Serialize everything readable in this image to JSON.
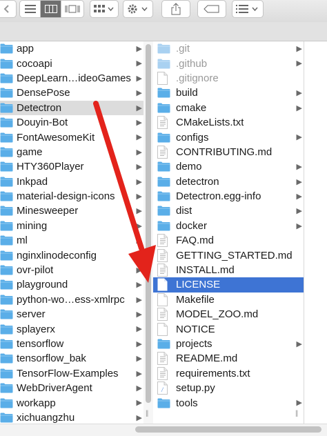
{
  "colors": {
    "folder": "#5aaee8",
    "selection_blue": "#3e74d4",
    "selection_grey": "#dcdcdc",
    "arrow": "#e3231b"
  },
  "toolbar": {
    "view_modes": [
      "list-view-icon",
      "column-view-icon",
      "gallery-view-icon"
    ],
    "active_view": "column-view",
    "buttons": [
      "arrange-icon",
      "action-gear-icon",
      "share-icon",
      "tag-icon",
      "group-icon"
    ]
  },
  "left_column": [
    {
      "name": "app",
      "type": "folder"
    },
    {
      "name": "cocoapi",
      "type": "folder"
    },
    {
      "name": "DeepLearn…ideoGames",
      "type": "folder"
    },
    {
      "name": "DensePose",
      "type": "folder"
    },
    {
      "name": "Detectron",
      "type": "folder",
      "selected": true
    },
    {
      "name": "Douyin-Bot",
      "type": "folder"
    },
    {
      "name": "FontAwesomeKit",
      "type": "folder"
    },
    {
      "name": "game",
      "type": "folder"
    },
    {
      "name": "HTY360Player",
      "type": "folder"
    },
    {
      "name": "Inkpad",
      "type": "folder"
    },
    {
      "name": "material-design-icons",
      "type": "folder"
    },
    {
      "name": "Minesweeper",
      "type": "folder"
    },
    {
      "name": "mining",
      "type": "folder"
    },
    {
      "name": "ml",
      "type": "folder"
    },
    {
      "name": "nginxlinodeconfig",
      "type": "folder"
    },
    {
      "name": "ovr-pilot",
      "type": "folder"
    },
    {
      "name": "playground",
      "type": "folder"
    },
    {
      "name": "python-wo…ess-xmlrpc",
      "type": "folder"
    },
    {
      "name": "server",
      "type": "folder"
    },
    {
      "name": "splayerx",
      "type": "folder"
    },
    {
      "name": "tensorflow",
      "type": "folder"
    },
    {
      "name": "tensorflow_bak",
      "type": "folder"
    },
    {
      "name": "TensorFlow-Examples",
      "type": "folder"
    },
    {
      "name": "WebDriverAgent",
      "type": "folder"
    },
    {
      "name": "workapp",
      "type": "folder"
    },
    {
      "name": "xichuangzhu",
      "type": "folder"
    }
  ],
  "right_column": [
    {
      "name": ".git",
      "type": "folder",
      "hidden": true
    },
    {
      "name": ".github",
      "type": "folder",
      "hidden": true
    },
    {
      "name": ".gitignore",
      "type": "file",
      "hidden": true
    },
    {
      "name": "build",
      "type": "folder"
    },
    {
      "name": "cmake",
      "type": "folder"
    },
    {
      "name": "CMakeLists.txt",
      "type": "text"
    },
    {
      "name": "configs",
      "type": "folder"
    },
    {
      "name": "CONTRIBUTING.md",
      "type": "text"
    },
    {
      "name": "demo",
      "type": "folder"
    },
    {
      "name": "detectron",
      "type": "folder"
    },
    {
      "name": "Detectron.egg-info",
      "type": "folder"
    },
    {
      "name": "dist",
      "type": "folder"
    },
    {
      "name": "docker",
      "type": "folder"
    },
    {
      "name": "FAQ.md",
      "type": "text"
    },
    {
      "name": "GETTING_STARTED.md",
      "type": "text"
    },
    {
      "name": "INSTALL.md",
      "type": "text"
    },
    {
      "name": "LICENSE",
      "type": "file",
      "selected": true
    },
    {
      "name": "Makefile",
      "type": "file"
    },
    {
      "name": "MODEL_ZOO.md",
      "type": "text"
    },
    {
      "name": "NOTICE",
      "type": "file"
    },
    {
      "name": "projects",
      "type": "folder"
    },
    {
      "name": "README.md",
      "type": "text"
    },
    {
      "name": "requirements.txt",
      "type": "text"
    },
    {
      "name": "setup.py",
      "type": "python"
    },
    {
      "name": "tools",
      "type": "folder"
    }
  ]
}
